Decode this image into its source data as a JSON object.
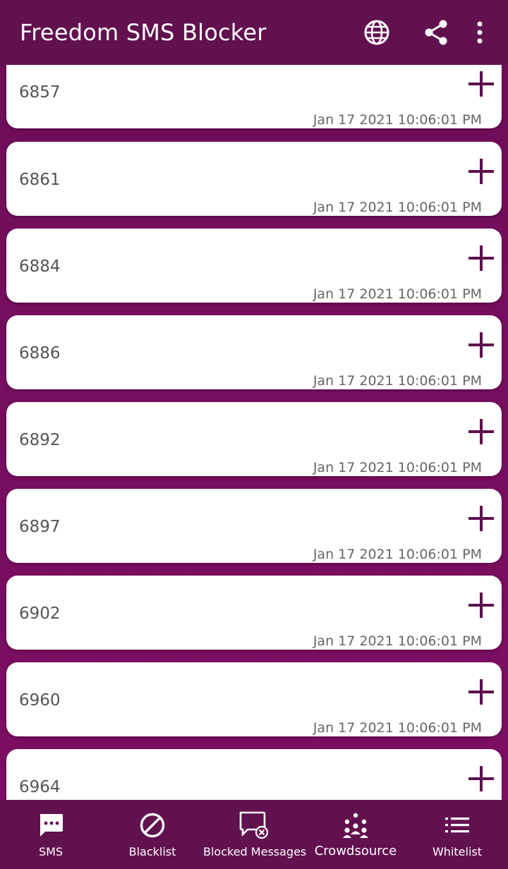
{
  "app": {
    "title": "Freedom SMS Blocker",
    "actions": [
      {
        "icon": "globe-icon"
      },
      {
        "icon": "share-icon"
      },
      {
        "icon": "more-vert-icon"
      }
    ]
  },
  "list": {
    "items": [
      {
        "number": "6857",
        "time": "Jan 17 2021 10:06:01 PM"
      },
      {
        "number": "6861",
        "time": "Jan 17 2021 10:06:01 PM"
      },
      {
        "number": "6884",
        "time": "Jan 17 2021 10:06:01 PM"
      },
      {
        "number": "6886",
        "time": "Jan 17 2021 10:06:01 PM"
      },
      {
        "number": "6892",
        "time": "Jan 17 2021 10:06:01 PM"
      },
      {
        "number": "6897",
        "time": "Jan 17 2021 10:06:01 PM"
      },
      {
        "number": "6902",
        "time": "Jan 17 2021 10:06:01 PM"
      },
      {
        "number": "6960",
        "time": "Jan 17 2021 10:06:01 PM"
      },
      {
        "number": "6964",
        "time": ""
      }
    ]
  },
  "nav": {
    "items": [
      {
        "label": "SMS",
        "icon": "sms-icon"
      },
      {
        "label": "Blacklist",
        "icon": "block-icon"
      },
      {
        "label": "Blocked Messages",
        "icon": "blocked-message-icon"
      },
      {
        "label": "Crowdsource",
        "icon": "crowdsource-icon"
      },
      {
        "label": "Whitelist",
        "icon": "list-icon"
      }
    ]
  },
  "colors": {
    "appbar": "#62114f",
    "background": "#7a0e60",
    "accent": "#5d0f4b"
  }
}
